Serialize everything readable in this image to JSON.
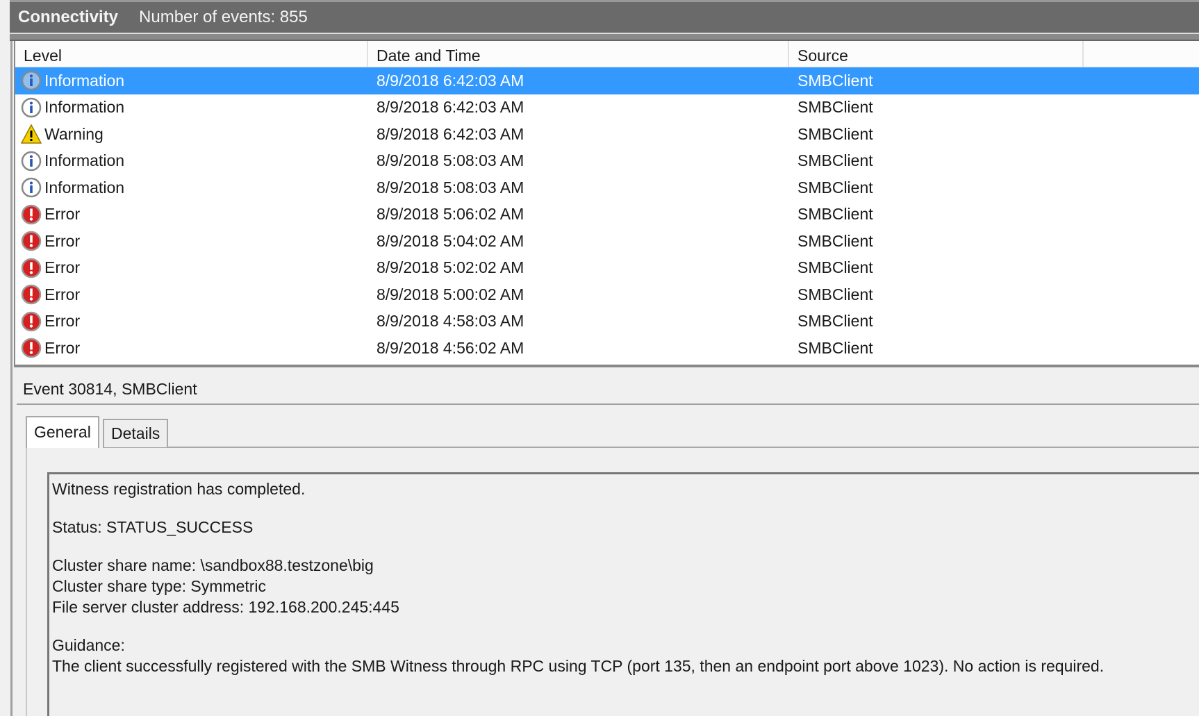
{
  "header": {
    "title": "Connectivity",
    "event_count": "Number of events: 855"
  },
  "columns": [
    "Level",
    "Date and Time",
    "Source"
  ],
  "rows": [
    {
      "level": "Information",
      "icon": "info-icon",
      "datetime": "8/9/2018 6:42:03 AM",
      "source": "SMBClient",
      "selected": true
    },
    {
      "level": "Information",
      "icon": "info-icon",
      "datetime": "8/9/2018 6:42:03 AM",
      "source": "SMBClient"
    },
    {
      "level": "Warning",
      "icon": "warning-icon",
      "datetime": "8/9/2018 6:42:03 AM",
      "source": "SMBClient"
    },
    {
      "level": "Information",
      "icon": "info-icon",
      "datetime": "8/9/2018 5:08:03 AM",
      "source": "SMBClient"
    },
    {
      "level": "Information",
      "icon": "info-icon",
      "datetime": "8/9/2018 5:08:03 AM",
      "source": "SMBClient"
    },
    {
      "level": "Error",
      "icon": "error-icon",
      "datetime": "8/9/2018 5:06:02 AM",
      "source": "SMBClient"
    },
    {
      "level": "Error",
      "icon": "error-icon",
      "datetime": "8/9/2018 5:04:02 AM",
      "source": "SMBClient"
    },
    {
      "level": "Error",
      "icon": "error-icon",
      "datetime": "8/9/2018 5:02:02 AM",
      "source": "SMBClient"
    },
    {
      "level": "Error",
      "icon": "error-icon",
      "datetime": "8/9/2018 5:00:02 AM",
      "source": "SMBClient"
    },
    {
      "level": "Error",
      "icon": "error-icon",
      "datetime": "8/9/2018 4:58:03 AM",
      "source": "SMBClient"
    },
    {
      "level": "Error",
      "icon": "error-icon",
      "datetime": "8/9/2018 4:56:02 AM",
      "source": "SMBClient"
    }
  ],
  "detail": {
    "title": "Event 30814, SMBClient",
    "tabs": [
      "General",
      "Details"
    ],
    "lines": [
      "Witness registration has completed.",
      "",
      "Status: STATUS_SUCCESS",
      "",
      "Cluster share name: \\sandbox88.testzone\\big",
      "Cluster share type: Symmetric",
      "File server cluster address: 192.168.200.245:445",
      "",
      "Guidance:",
      "The client successfully registered with the SMB Witness through RPC using TCP (port 135, then an endpoint port above 1023). No action is required."
    ]
  },
  "colors": {
    "selection": "#3399ff",
    "titlebar": "#6a6a6a"
  }
}
